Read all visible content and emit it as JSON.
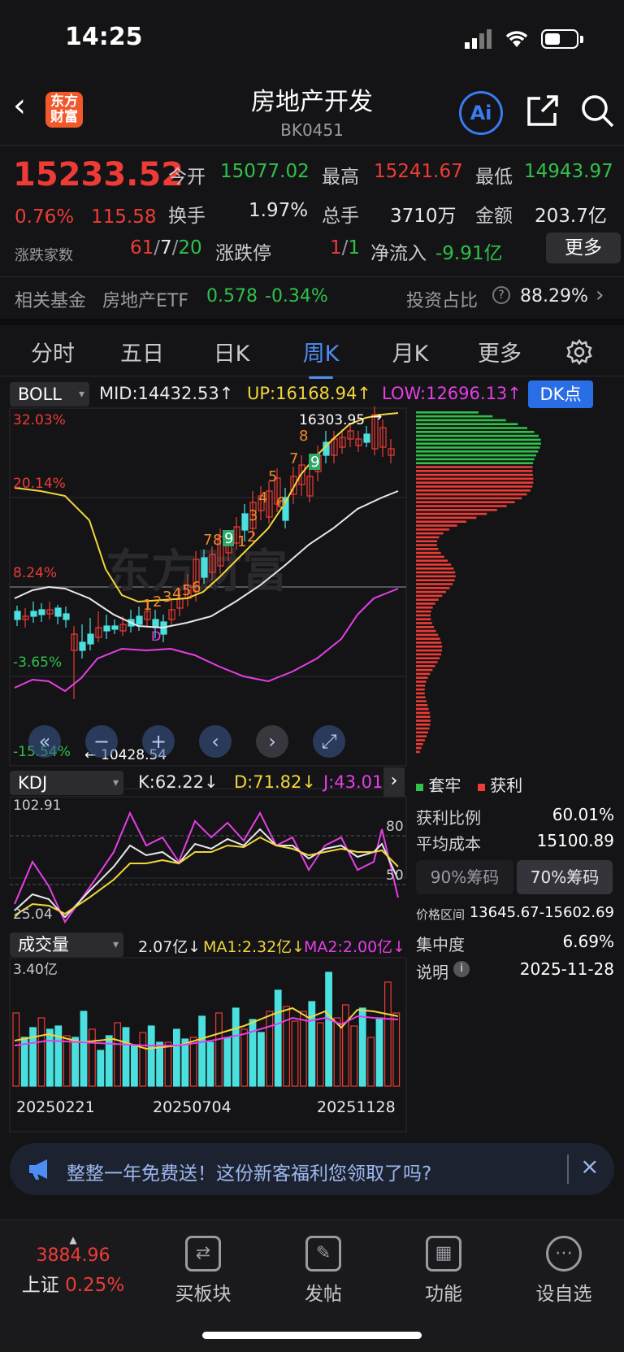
{
  "status": {
    "time": "14:25"
  },
  "header": {
    "logo_line1": "东方",
    "logo_line2": "财富",
    "title": "房地产开发",
    "code": "BK0451",
    "ai_label": "Ai"
  },
  "quote": {
    "price": "15233.52",
    "change_pct": "0.76%",
    "change": "115.58",
    "open_label": "今开",
    "open": "15077.02",
    "high_label": "最高",
    "high": "15241.67",
    "low_label": "最低",
    "low": "14943.97",
    "turnover_label": "换手",
    "turnover": "1.97%",
    "volume_label": "总手",
    "volume": "3710万",
    "amount_label": "金额",
    "amount": "203.7亿",
    "breadth_label": "涨跌家数",
    "breadth_up": "61",
    "breadth_flat": "7",
    "breadth_down": "20",
    "sep": "/",
    "limit_label": "涨跌停",
    "limit_up": "1",
    "limit_down": "1",
    "netflow_label": "净流入",
    "netflow": "-9.91亿",
    "more_label": "更多"
  },
  "fund": {
    "label": "相关基金",
    "name": "房地产ETF",
    "price": "0.578",
    "change": "-0.34%",
    "ratio_label": "投资占比",
    "ratio": "88.29%"
  },
  "tabs": [
    {
      "label": "分时"
    },
    {
      "label": "五日"
    },
    {
      "label": "日K"
    },
    {
      "label": "周K"
    },
    {
      "label": "月K"
    },
    {
      "label": "更多"
    }
  ],
  "boll": {
    "name": "BOLL",
    "mid": "MID:14432.53↑",
    "up": "UP:16168.94↑",
    "low": "LOW:12696.13↑",
    "dk": "DK点",
    "y_labels": [
      "32.03%",
      "20.14%",
      "8.24%",
      "-3.65%",
      "-15.54%"
    ],
    "high_mark": "16303.95",
    "low_mark": "10428.54",
    "watermark": "东方财富"
  },
  "kdj": {
    "name": "KDJ",
    "k": "K:62.22↓",
    "d": "D:71.82↓",
    "j": "J:43.01",
    "y_top": "102.91",
    "y_bottom": "25.04",
    "level_high": "80",
    "level_low": "50"
  },
  "volume": {
    "name": "成交量",
    "val": "2.07亿↓",
    "ma1": "MA1:2.32亿↓",
    "ma2": "MA2:2.00亿↓",
    "y_top": "3.40亿",
    "dates": [
      "20250221",
      "20250704",
      "20251128"
    ]
  },
  "chips": {
    "legend_trapped": "套牢",
    "legend_profit": "获利",
    "profit_ratio_label": "获利比例",
    "profit_ratio": "60.01%",
    "avg_cost_label": "平均成本",
    "avg_cost": "15100.89",
    "btn_90": "90%筹码",
    "btn_70": "70%筹码",
    "range_label": "价格区间",
    "range": "13645.67-15602.69",
    "concentration_label": "集中度",
    "concentration": "6.69%",
    "note_label": "说明",
    "date": "2025-11-28"
  },
  "banner": {
    "text": "整整一年免费送！这份新客福利您领取了吗?"
  },
  "bottom_nav": {
    "index_value": "3884.96",
    "index_name": "上证",
    "index_change": "0.25%",
    "items": [
      {
        "label": "买板块"
      },
      {
        "label": "发帖"
      },
      {
        "label": "功能"
      },
      {
        "label": "设自选"
      }
    ]
  },
  "colors": {
    "up": "#ee3b36",
    "down": "#2fc14a",
    "accent": "#4d8ef5",
    "boll_mid": "#e8e8ec",
    "boll_up": "#f2d53a",
    "boll_low": "#e63ee6"
  }
}
